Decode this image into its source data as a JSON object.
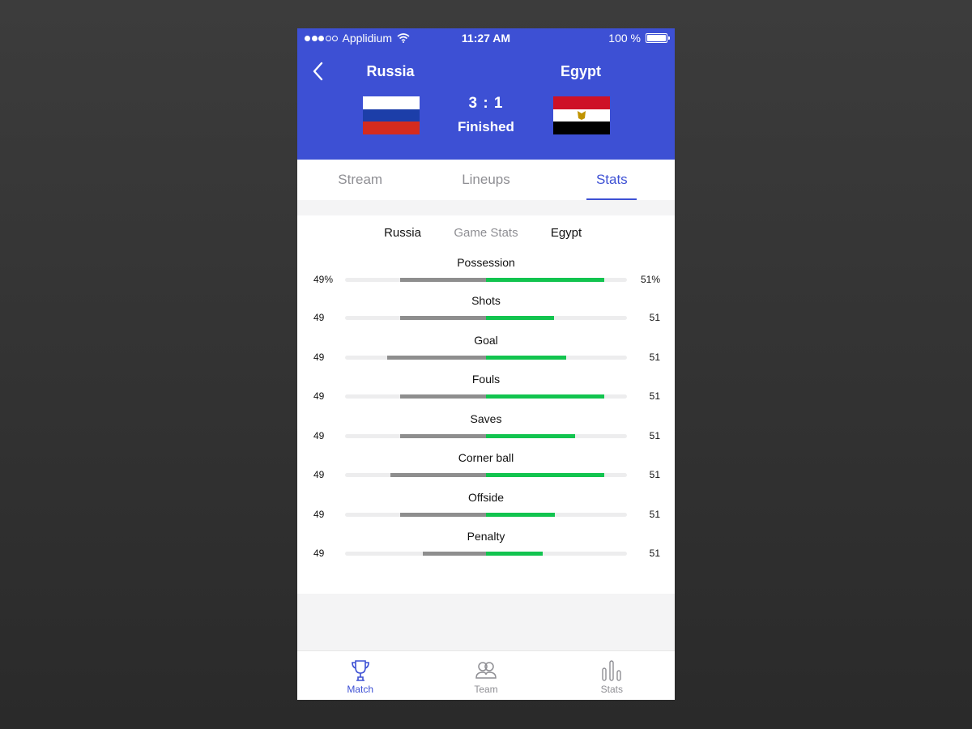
{
  "status_bar": {
    "carrier": "Applidium",
    "time": "11:27 AM",
    "battery": "100 %"
  },
  "match": {
    "home_team": "Russia",
    "away_team": "Egypt",
    "score": "3 : 1",
    "status": "Finished",
    "flags": {
      "home": [
        "#ffffff",
        "#1c3ea9",
        "#d52b1e"
      ],
      "away": [
        "#ce1126",
        "#ffffff",
        "#000000"
      ],
      "emblem": "#c09300"
    }
  },
  "tabs": [
    {
      "label": "Stream",
      "active": false
    },
    {
      "label": "Lineups",
      "active": false
    },
    {
      "label": "Stats",
      "active": true
    }
  ],
  "stats": {
    "home_label": "Russia",
    "title": "Game Stats",
    "away_label": "Egypt",
    "rows": [
      {
        "label": "Possession",
        "home": "49%",
        "away": "51%",
        "home_bar": 0.61,
        "away_bar": 0.84
      },
      {
        "label": "Shots",
        "home": "49",
        "away": "51",
        "home_bar": 0.61,
        "away_bar": 0.48
      },
      {
        "label": "Goal",
        "home": "49",
        "away": "51",
        "home_bar": 0.7,
        "away_bar": 0.57
      },
      {
        "label": "Fouls",
        "home": "49",
        "away": "51",
        "home_bar": 0.61,
        "away_bar": 0.84
      },
      {
        "label": "Saves",
        "home": "49",
        "away": "51",
        "home_bar": 0.61,
        "away_bar": 0.63
      },
      {
        "label": "Corner ball",
        "home": "49",
        "away": "51",
        "home_bar": 0.68,
        "away_bar": 0.84
      },
      {
        "label": "Offside",
        "home": "49",
        "away": "51",
        "home_bar": 0.61,
        "away_bar": 0.49
      },
      {
        "label": "Penalty",
        "home": "49",
        "away": "51",
        "home_bar": 0.45,
        "away_bar": 0.4
      }
    ]
  },
  "colors": {
    "accent": "#3d50d4",
    "home_bar": "#8e8e8e",
    "away_bar": "#12c44f"
  },
  "tabbar": [
    {
      "label": "Match",
      "icon": "trophy-icon",
      "active": true
    },
    {
      "label": "Team",
      "icon": "team-icon",
      "active": false
    },
    {
      "label": "Stats",
      "icon": "bar-chart-icon",
      "active": false
    }
  ]
}
